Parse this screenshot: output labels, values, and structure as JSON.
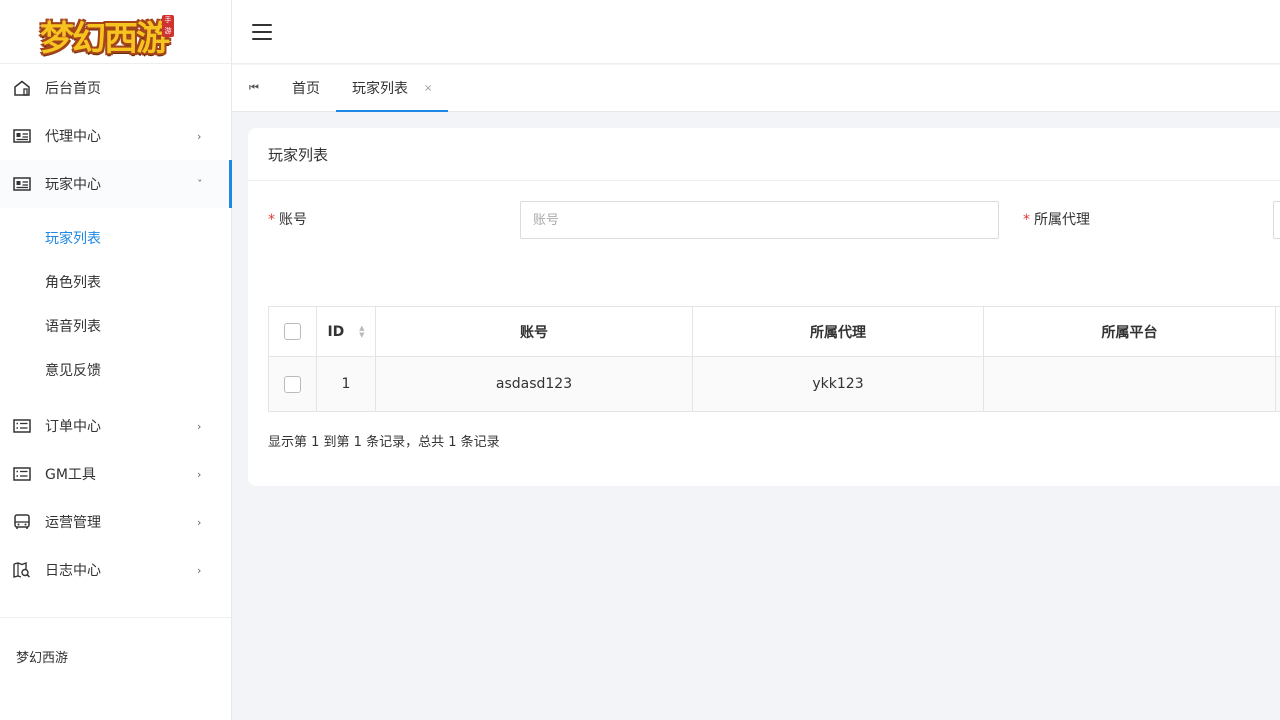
{
  "logo": {
    "text": "梦幻西游",
    "seal": "手游"
  },
  "sidebar": {
    "items": [
      {
        "label": "后台首页",
        "icon": "home-icon",
        "arrow": ""
      },
      {
        "label": "代理中心",
        "icon": "id-card-icon",
        "arrow": "›"
      },
      {
        "label": "玩家中心",
        "icon": "id-card-icon",
        "arrow": "ˇ"
      }
    ],
    "submenu": [
      {
        "label": "玩家列表"
      },
      {
        "label": "角色列表"
      },
      {
        "label": "语音列表"
      },
      {
        "label": "意见反馈"
      }
    ],
    "items_after": [
      {
        "label": "订单中心",
        "icon": "list-icon",
        "arrow": "›"
      },
      {
        "label": "GM工具",
        "icon": "list-icon",
        "arrow": "›"
      },
      {
        "label": "运营管理",
        "icon": "bus-icon",
        "arrow": "›"
      },
      {
        "label": "日志中心",
        "icon": "map-search-icon",
        "arrow": "›"
      }
    ],
    "footer": "梦幻西游"
  },
  "tabs": {
    "back": "⏮",
    "items": [
      {
        "label": "首页"
      },
      {
        "label": "玩家列表",
        "close": "×"
      }
    ]
  },
  "card": {
    "title": "玩家列表",
    "form": {
      "account_label": "账号",
      "account_placeholder": "账号",
      "agent_label": "所属代理",
      "required_mark": "*"
    },
    "table": {
      "headers": [
        "ID",
        "账号",
        "所属代理",
        "所属平台"
      ],
      "rows": [
        {
          "id": "1",
          "account": "asdasd123",
          "agent": "ykk123",
          "platform": ""
        }
      ]
    },
    "pagination_info": "显示第 1 到第 1 条记录，总共 1 条记录"
  },
  "colors": {
    "accent": "#1e88e5",
    "required": "#e53935"
  }
}
